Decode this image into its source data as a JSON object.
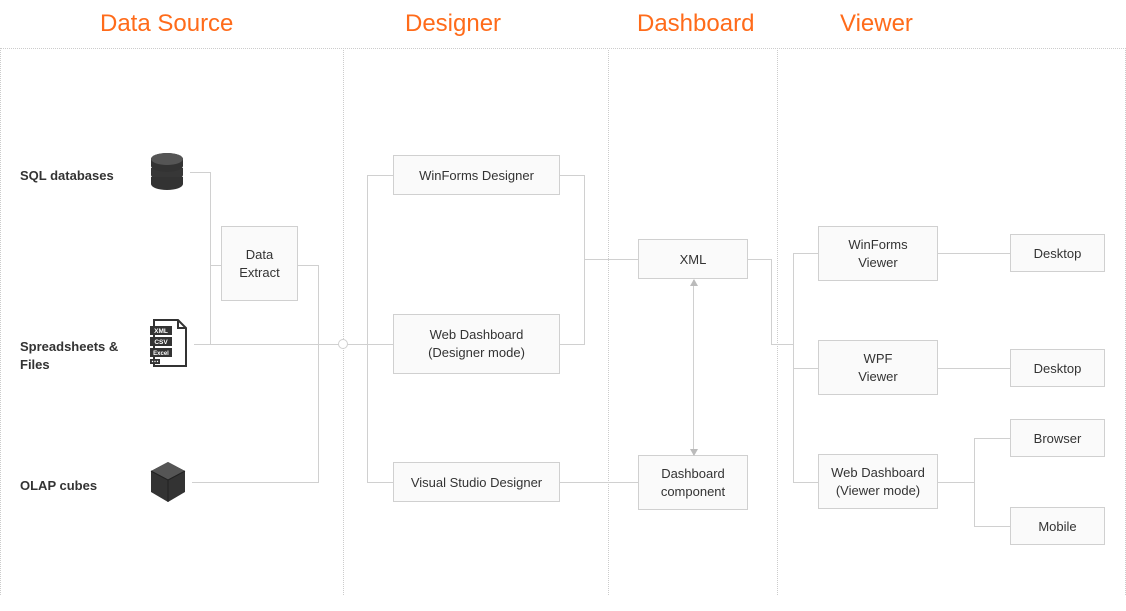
{
  "columns": {
    "dataSource": "Data Source",
    "designer": "Designer",
    "dashboard": "Dashboard",
    "viewer": "Viewer"
  },
  "dataSources": {
    "sql": "SQL databases",
    "files": "Spreadsheets &\nFiles",
    "olap": "OLAP cubes",
    "extractBox": "Data\nExtract",
    "fileBadges": [
      "XML",
      "CSV",
      "Excel"
    ]
  },
  "designers": {
    "winforms": "WinForms Designer",
    "web": "Web Dashboard\n(Designer mode)",
    "vs": "Visual Studio Designer"
  },
  "dashboard": {
    "xml": "XML",
    "component": "Dashboard\ncomponent"
  },
  "viewers": {
    "winforms": "WinForms\nViewer",
    "wpf": "WPF\nViewer",
    "web": "Web Dashboard\n(Viewer mode)"
  },
  "targets": {
    "desktop1": "Desktop",
    "desktop2": "Desktop",
    "browser": "Browser",
    "mobile": "Mobile"
  },
  "colors": {
    "accent": "#ff6b1a",
    "iconFill": "#333333"
  }
}
